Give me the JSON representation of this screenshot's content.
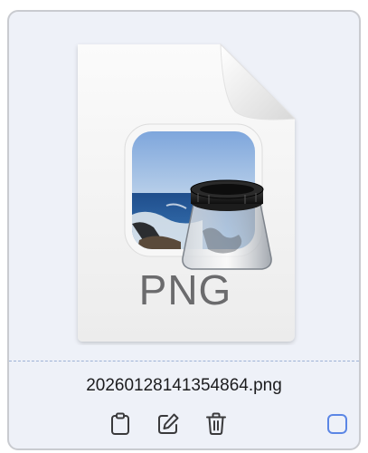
{
  "file": {
    "name": "20260128141354864.png",
    "extension": "PNG",
    "icon": "preview-app-png-document-icon"
  },
  "actions": [
    {
      "name": "copy",
      "icon": "clipboard-icon"
    },
    {
      "name": "edit",
      "icon": "pencil-square-icon"
    },
    {
      "name": "delete",
      "icon": "trash-icon"
    }
  ],
  "selection": {
    "checked": false,
    "accent_color": "#5b86e5"
  },
  "colors": {
    "card_background": "#eef1f8",
    "card_border": "#c9cbd0",
    "divider": "#9eb2d6",
    "icon_stroke": "#3a3a3c"
  }
}
